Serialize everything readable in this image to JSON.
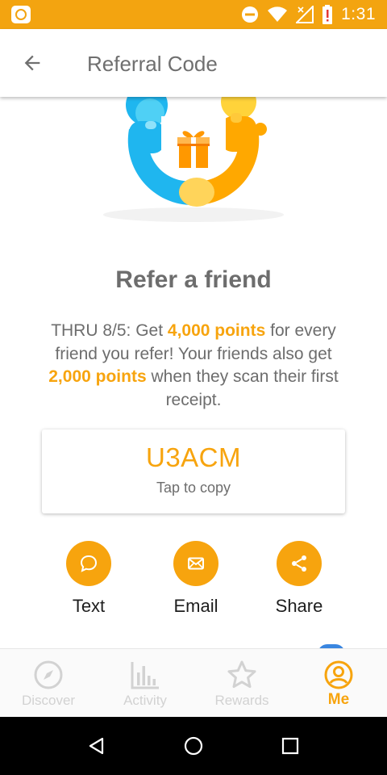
{
  "status_bar": {
    "time": "1:31",
    "icons": [
      "app-notification-icon",
      "do-not-disturb-icon",
      "wifi-icon",
      "signal-icon",
      "battery-alert-icon"
    ],
    "background": "#f3a410"
  },
  "app_bar": {
    "title": "Referral Code",
    "back_icon": "arrow-back-icon"
  },
  "hero": {
    "icon": "gift-icon"
  },
  "referral": {
    "heading": "Refer a friend",
    "desc_intro": "THRU 8/5: Get ",
    "referrer_points": "4,000 points",
    "desc_mid": " for every friend you refer! Your friends also get ",
    "friend_points": "2,000 points",
    "desc_end": " when they scan their first receipt.",
    "code": "U3ACM",
    "copy_hint": "Tap to copy"
  },
  "share_options": [
    {
      "label": "Text",
      "icon": "chat-bubble-icon"
    },
    {
      "label": "Email",
      "icon": "envelope-icon"
    },
    {
      "label": "Share",
      "icon": "share-icon"
    }
  ],
  "bottom_nav": [
    {
      "label": "Discover",
      "icon": "compass-icon",
      "active": false
    },
    {
      "label": "Activity",
      "icon": "bar-chart-icon",
      "active": false
    },
    {
      "label": "Rewards",
      "icon": "star-icon",
      "active": false
    },
    {
      "label": "Me",
      "icon": "person-circle-icon",
      "active": true
    }
  ],
  "system_nav": {
    "icons": [
      "back-triangle-icon",
      "home-circle-icon",
      "recents-square-icon"
    ]
  },
  "colors": {
    "accent": "#f7a40e",
    "text_primary": "#6d6d6d",
    "nav_inactive": "#d2d2d2",
    "hero_blue": "#1fb6ef",
    "hero_orange": "#ffa800"
  }
}
